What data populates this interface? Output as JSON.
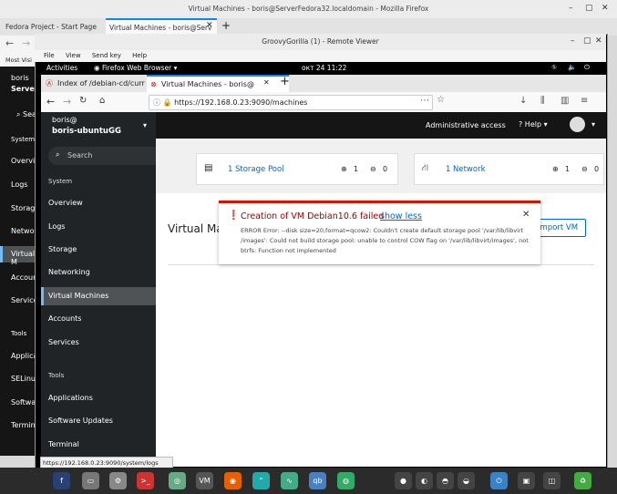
{
  "outer_window": {
    "title": "Virtual Machines - boris@ServerFedora32.localdomain - Mozilla Firefox",
    "tabs": [
      {
        "label": "Fedora Project - Start Page"
      },
      {
        "label": "Virtual Machines - boris@Serv"
      }
    ],
    "most_visited": "Most Visi",
    "sidebar_host_user": "boris",
    "sidebar_host_name": "ServerF",
    "sidebar_search": "Sea",
    "sidebar_system": "System",
    "sidebar_items": [
      "Overvie",
      "Logs",
      "Storage",
      "Network",
      "Virtual M",
      "Accoun",
      "Services"
    ],
    "sidebar_tools": "Tools",
    "sidebar_tool_items": [
      "Applicat",
      "SELinux",
      "Softwa",
      "Termina"
    ]
  },
  "remote_viewer": {
    "title": "GroovyGorilla (1) - Remote Viewer",
    "menu": [
      "File",
      "View",
      "Send key",
      "Help"
    ]
  },
  "gnome": {
    "activities": "Activities",
    "app": "Firefox Web Browser",
    "clock": "окт 24  11:22"
  },
  "inner_browser": {
    "tabs": [
      {
        "label": "Index of /debian-cd/curr"
      },
      {
        "label": "Virtual Machines - boris@"
      }
    ],
    "url": "https://192.168.0.23:9090/machines"
  },
  "cockpit": {
    "user": "boris@",
    "host": "boris-ubuntuGG",
    "search_placeholder": "Search",
    "admin_access": "Administrative access",
    "help": "Help",
    "system_label": "System",
    "nav": [
      {
        "label": "Overview",
        "active": false
      },
      {
        "label": "Logs",
        "active": false
      },
      {
        "label": "Storage",
        "active": false
      },
      {
        "label": "Networking",
        "active": false
      },
      {
        "label": "Virtual Machines",
        "active": true
      },
      {
        "label": "Accounts",
        "active": false
      },
      {
        "label": "Services",
        "active": false
      }
    ],
    "tools_label": "Tools",
    "tools": [
      {
        "label": "Applications"
      },
      {
        "label": "Software Updates"
      },
      {
        "label": "Terminal"
      }
    ],
    "storage_card": {
      "count": "1",
      "label": "Storage Pool",
      "up": "1",
      "down": "0"
    },
    "network_card": {
      "count": "1",
      "label": "Network",
      "up": "1",
      "down": "0"
    },
    "section_title": "Virtual Ma",
    "import_vm": "Import VM"
  },
  "alert": {
    "title": "Creation of VM Debian10.6 failed",
    "toggle": "show less",
    "message": "ERROR Error: --disk size=20,format=qcow2: Couldn't create default storage pool '/var/lib/libvirt /images': Could not build storage pool: unable to control COW flag on '/var/lib/libvirt/images', not btrfs: Function not implemented"
  },
  "status_tooltip": "https://192.168.0.23:9090/system/logs",
  "taskbar_icons": [
    "fedora-icon",
    "files-icon",
    "settings-icon",
    "terminal-icon",
    "camera-icon",
    "virt-manager-icon",
    "firefox-icon",
    "quotes-icon",
    "monitor-icon",
    "qbittorrent-icon",
    "spice-icon"
  ],
  "colors": {
    "danger": "#c9190b",
    "link": "#0066cc",
    "accent": "#0a84ff"
  }
}
